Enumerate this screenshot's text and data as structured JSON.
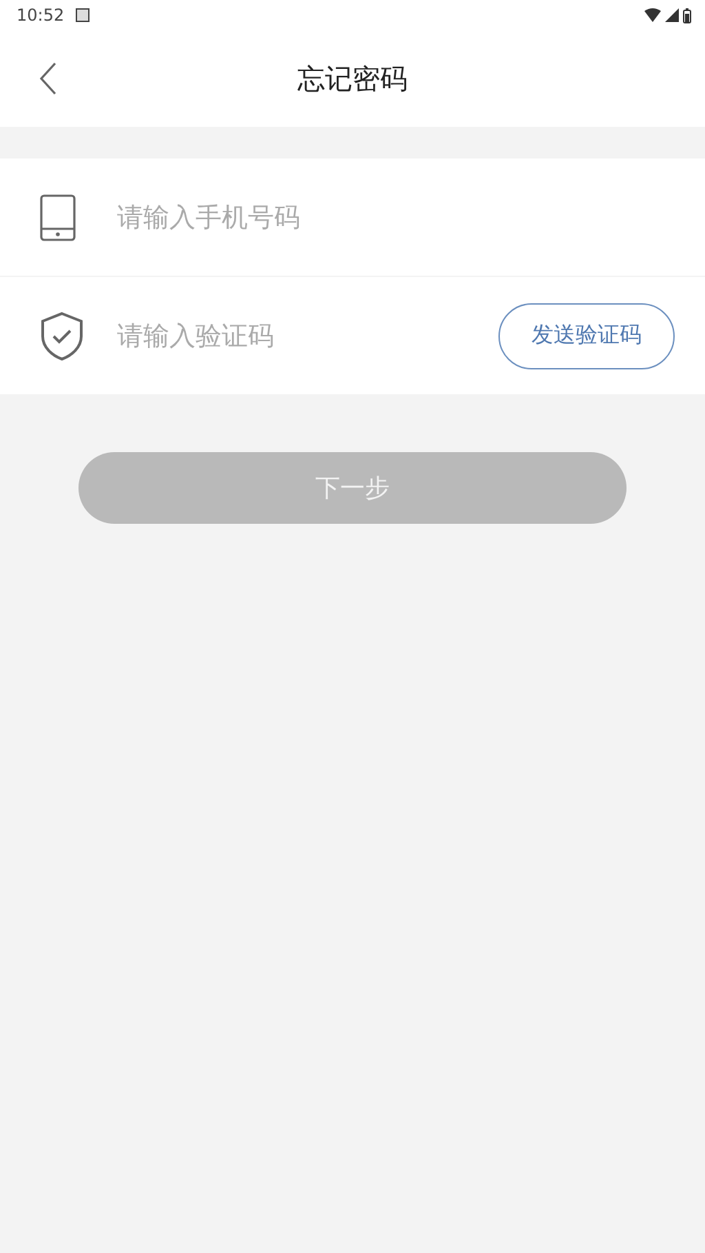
{
  "status_bar": {
    "time": "10:52"
  },
  "header": {
    "title": "忘记密码"
  },
  "fields": [
    {
      "kind": "phone",
      "placeholder": "请输入手机号码"
    },
    {
      "kind": "code",
      "placeholder": "请输入验证码",
      "button": "发送验证码"
    }
  ],
  "next_button": {
    "label": "下一步",
    "disabled": true
  }
}
